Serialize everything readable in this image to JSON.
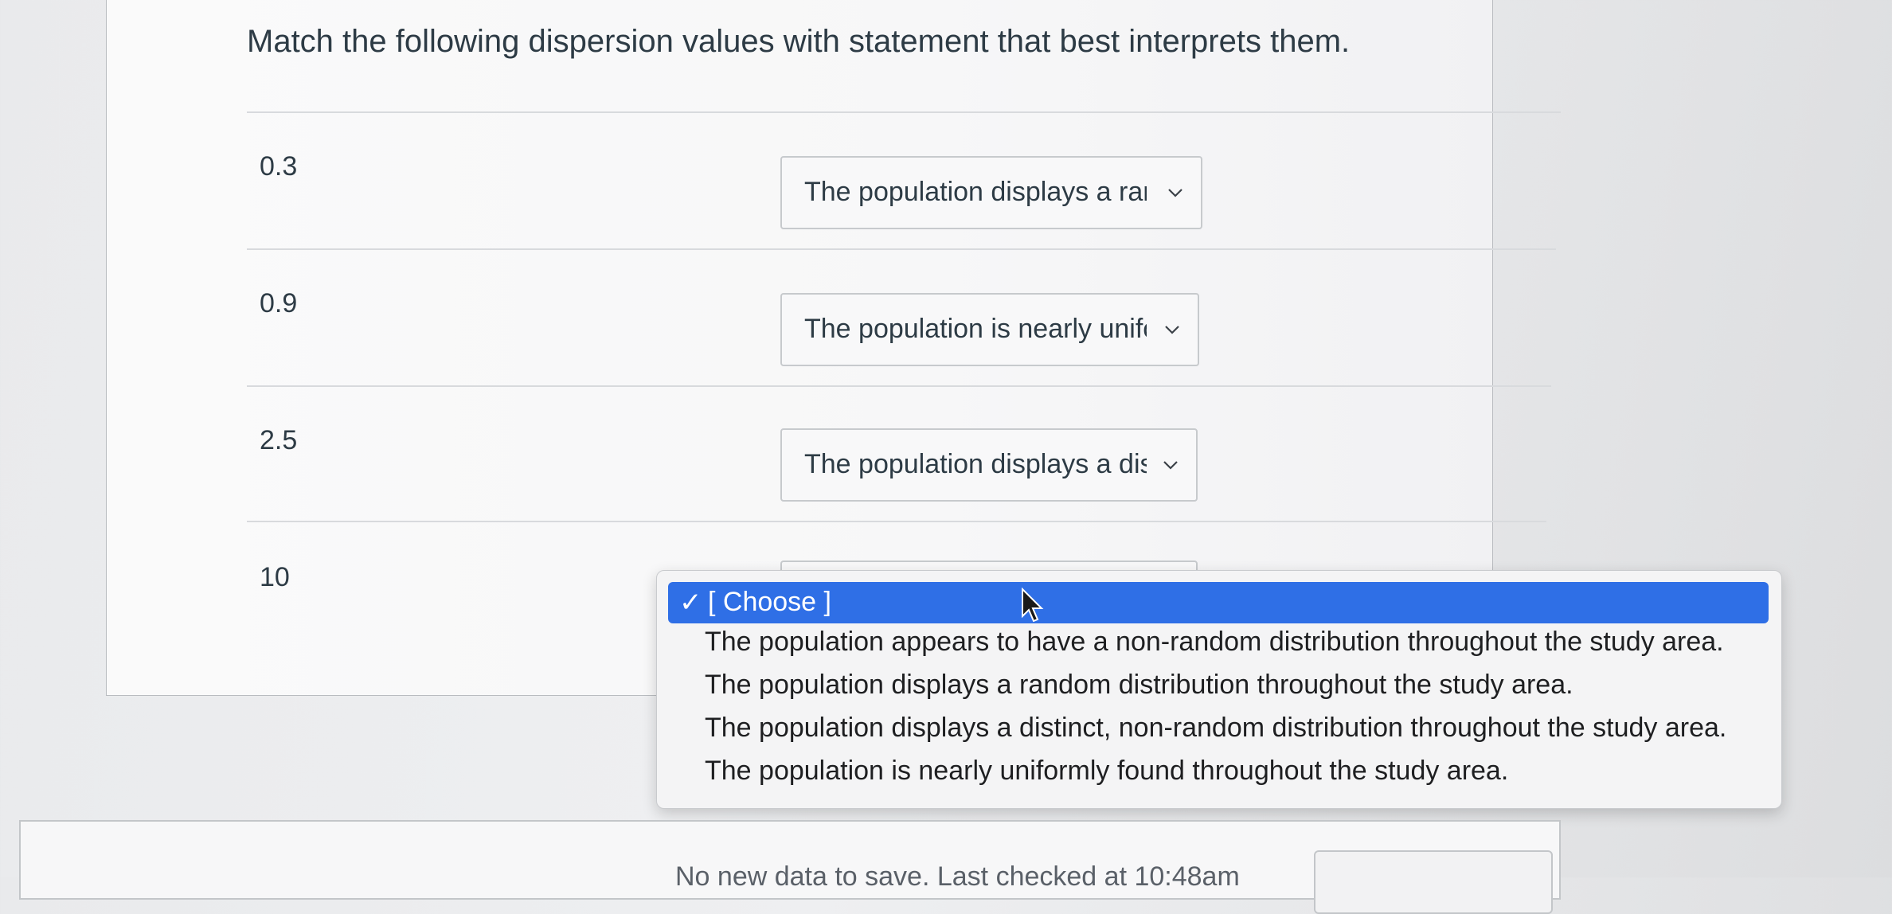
{
  "question": {
    "prompt": "Match the following dispersion values with statement that best interprets them.",
    "rows": [
      {
        "value": "0.3",
        "selected": "The population displays a ranc"
      },
      {
        "value": "0.9",
        "selected": "The population is nearly unifo"
      },
      {
        "value": "2.5",
        "selected": "The population displays a dist"
      },
      {
        "value": "10",
        "selected": ""
      }
    ]
  },
  "dropdown": {
    "check_glyph": "✓",
    "selected_label": "[ Choose ]",
    "options": [
      "The population appears to have a non-random distribution throughout the study area.",
      "The population displays a random distribution throughout the study area.",
      "The population displays a distinct, non-random distribution throughout the study area.",
      "The population is nearly uniformly found throughout the study area."
    ]
  },
  "footer": {
    "status_text": "No new data to save. Last checked at 10:48am"
  },
  "colors": {
    "highlight": "#2f6fe6",
    "text": "#2d3b45"
  }
}
